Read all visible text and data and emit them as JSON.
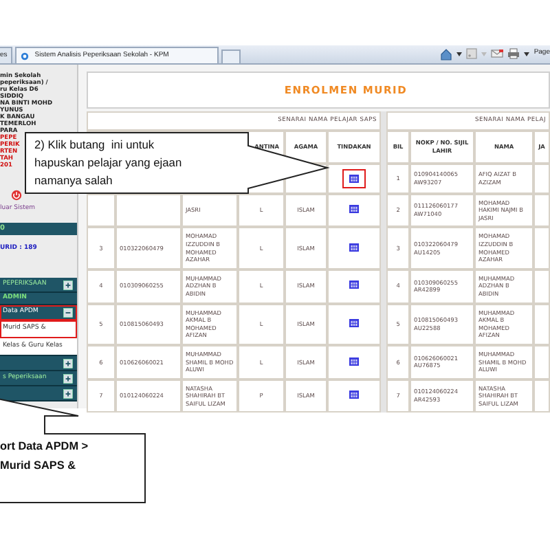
{
  "browser": {
    "tabs": [
      {
        "label": "es",
        "selected": false
      },
      {
        "label": "Sistem Analisis Peperiksaan Sekolah - KPM",
        "selected": true
      }
    ],
    "new_tab": true,
    "toolbar_label": "Page"
  },
  "sidebar": {
    "profile_lines": [
      {
        "text": "min Sekolah",
        "kind": "plain"
      },
      {
        "text": "peperiksaan) /",
        "kind": "plain"
      },
      {
        "text": "ru Kelas D6",
        "kind": "plain"
      },
      {
        "text": "SIDDIQ",
        "kind": "plain"
      },
      {
        "text": "NA BINTI MOHD",
        "kind": "plain"
      },
      {
        "text": "YUNUS",
        "kind": "plain"
      },
      {
        "text": "K BANGAU",
        "kind": "plain"
      },
      {
        "text": "TEMERLOH",
        "kind": "plain"
      },
      {
        "text": "PARA",
        "kind": "plain"
      },
      {
        "text": "PEPE",
        "kind": "alert"
      },
      {
        "text": "PERIK",
        "kind": "alert"
      },
      {
        "text": "RTEN",
        "kind": "alert"
      },
      {
        "text": "TAH",
        "kind": "alert"
      },
      {
        "text": "201",
        "kind": "alert"
      }
    ],
    "logout": "luar Sistem",
    "status": "0",
    "count": "URID : 189",
    "menu": [
      {
        "label": "PEPERIKSAAN",
        "kind": "bar",
        "expanded": false,
        "highlighted": false
      },
      {
        "label": "ADMIN",
        "kind": "section",
        "highlighted": false
      },
      {
        "label": "Data APDM",
        "kind": "bar",
        "expanded": true,
        "highlighted": true
      },
      {
        "label": "Murid SAPS &",
        "kind": "item",
        "highlighted": true
      },
      {
        "label": "Kelas & Guru Kelas",
        "kind": "item",
        "highlighted": false
      },
      {
        "kind": "bar",
        "expanded": false,
        "highlighted": false
      },
      {
        "label": "s Peperiksaan",
        "kind": "bar",
        "expanded": false,
        "highlighted": false
      },
      {
        "kind": "bar",
        "expanded": false,
        "highlighted": false
      }
    ]
  },
  "page": {
    "title": "ENROLMEN MURID",
    "left_caption": "SENARAI NAMA PELAJAR SAPS",
    "right_caption": "SENARAI NAMA PELAJ",
    "left_columns": [
      "ANTINA",
      "AGAMA",
      "TINDAKAN"
    ],
    "left_rows": [
      {
        "highlighted": true
      },
      {
        "nama": "JASRI",
        "jantina": "L",
        "agama": "ISLAM",
        "highlighted": false
      },
      {
        "bil": "3",
        "nokp": "010322060479",
        "nama": "MOHAMAD IZZUDDIN B MOHAMED AZAHAR",
        "jantina": "L",
        "agama": "ISLAM",
        "highlighted": false
      },
      {
        "bil": "4",
        "nokp": "010309060255",
        "nama": "MUHAMMAD ADZHAN B ABIDIN",
        "jantina": "L",
        "agama": "ISLAM",
        "highlighted": false
      },
      {
        "bil": "5",
        "nokp": "010815060493",
        "nama": "MUHAMMAD AKMAL B MOHAMED AFIZAN",
        "jantina": "L",
        "agama": "ISLAM",
        "highlighted": false
      },
      {
        "bil": "6",
        "nokp": "010626060021",
        "nama": "MUHAMMAD SHAMIL B MOHD ALUWI",
        "jantina": "L",
        "agama": "ISLAM",
        "highlighted": false
      },
      {
        "bil": "7",
        "nokp": "010124060224",
        "nama": "NATASHA SHAHIRAH BT SAIFUL LIZAM",
        "jantina": "P",
        "agama": "ISLAM",
        "highlighted": false
      }
    ],
    "right_columns": [
      "BIL",
      "NOKP / NO. SIJIL LAHIR",
      "NAMA",
      "JA"
    ],
    "right_rows": [
      {
        "bil": "1",
        "nokp": "010904140065 AW93207",
        "nama": "AFIQ AIZAT B AZIZAM"
      },
      {
        "bil": "2",
        "nokp": "011126060177 AW71040",
        "nama": "MOHAMAD HAKIMI NAJMI B JASRI"
      },
      {
        "bil": "3",
        "nokp": "010322060479 AU14205",
        "nama": "MOHAMAD IZZUDDIN B MOHAMED AZAHAR"
      },
      {
        "bil": "4",
        "nokp": "010309060255 AR42899",
        "nama": "MUHAMMAD ADZHAN B ABIDIN"
      },
      {
        "bil": "5",
        "nokp": "010815060493 AU22588",
        "nama": "MUHAMMAD AKMAL B MOHAMED AFIZAN"
      },
      {
        "bil": "6",
        "nokp": "010626060021 AU76875",
        "nama": "MUHAMMAD SHAMIL B MOHD ALUWI"
      },
      {
        "bil": "7",
        "nokp": "010124060224 AR42593",
        "nama": "NATASHA SHAHIRAH BT SAIFUL LIZAM"
      }
    ]
  },
  "callouts": [
    {
      "text": "2) Klik butang  ini untuk\nhapuskan pelajar yang ejaan\nnamanya salah",
      "kind": "right"
    },
    {
      "text": "ort Data APDM >\nMurid SAPS &",
      "kind": "up"
    }
  ]
}
